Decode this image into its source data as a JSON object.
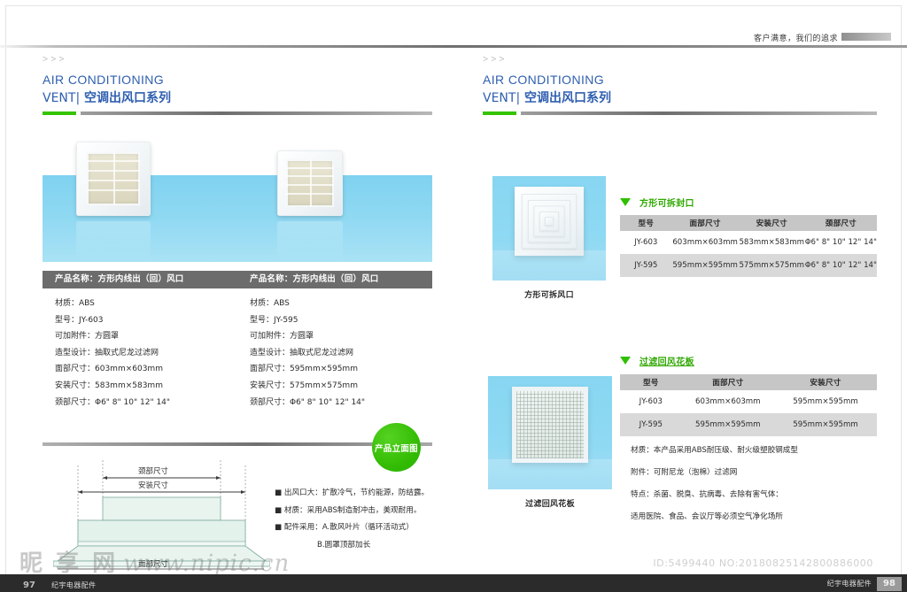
{
  "header": {
    "slogan": "客户满意，我们的追求"
  },
  "section_heading": {
    "arrows": ">>>",
    "english": "AIR CONDITIONING",
    "vent": "VENT|",
    "chinese": " 空调出风口系列"
  },
  "left_page": {
    "hero": {
      "product_left_alt": "方形内线出风口",
      "product_right_alt": "方形内线出风口"
    },
    "spec_columns": [
      {
        "title": "产品名称：方形内线出（回）风口",
        "rows": [
          "材质：ABS",
          "型号：JY-603",
          "可加附件：方圆罩",
          "造型设计：抽取式尼龙过滤网",
          "面部尺寸：603mm×603mm",
          "安装尺寸：583mm×583mm",
          "颈部尺寸：Φ6\" 8\"  10\"  12\"  14\""
        ]
      },
      {
        "title": "产品名称：方形内线出（回）风口",
        "rows": [
          "材质：ABS",
          "型号：JY-595",
          "可加附件：方圆罩",
          "造型设计：抽取式尼龙过滤网",
          "面部尺寸：595mm×595mm",
          "安装尺寸：575mm×575mm",
          "颈部尺寸：Φ6\" 8\"  10\"  12\"  14\""
        ]
      }
    ],
    "badge_label": "产品立面图",
    "drawing": {
      "neck_label": "颈部尺寸",
      "install_label": "安装尺寸",
      "face_label": "面部尺寸"
    },
    "bullets": [
      "■ 出风口大：扩散冷气，节约能源，防结露。",
      "■ 材质：采用ABS制造耐冲击，美观耐用。",
      "■ 配件采用：A.散风叶片（循环活动式）",
      "B.圆罩顶部加长"
    ]
  },
  "right_page": {
    "sections": [
      {
        "title": "方形可拆封口",
        "photo_caption": "方形可拆风口",
        "columns": [
          "型号",
          "面部尺寸",
          "安装尺寸",
          "颈部尺寸"
        ],
        "rows": [
          [
            "JY-603",
            "603mm×603mm",
            "583mm×583mm",
            "Φ6\" 8\"  10\"  12\"  14\""
          ],
          [
            "JY-595",
            "595mm×595mm",
            "575mm×575mm",
            "Φ6\" 8\"  10\"  12\"  14\""
          ]
        ]
      },
      {
        "title": "过滤回风花板",
        "photo_caption": "过滤回风花板",
        "columns": [
          "型号",
          "面部尺寸",
          "安装尺寸"
        ],
        "rows": [
          [
            "JY-603",
            "603mm×603mm",
            "595mm×595mm"
          ],
          [
            "JY-595",
            "595mm×595mm",
            "595mm×595mm"
          ]
        ],
        "notes": [
          "材质：本产品采用ABS耐压级、耐火级塑胶钢成型",
          "附件：可附尼龙（泡棉）过滤网",
          "特点：杀菌、脱臭、抗病毒、去除有害气体：",
          "适用医院、食品、会议厅等必须空气净化场所"
        ]
      }
    ]
  },
  "footer": {
    "brand_left": "纪宇电器配件",
    "brand_right": "纪宇电器配件",
    "page_left": "97",
    "page_right": "98",
    "stock_id": "ID:5499440 NO:20180825142800886000"
  },
  "watermark": {
    "logo": "昵 享 网",
    "url": "www.nipic.cn"
  },
  "colors": {
    "accent_blue": "#2f5fb0",
    "accent_green": "#35c400",
    "bar_dark": "#6c6c6c",
    "table_header": "#c6c6c6",
    "photo_bg": "#8fd9f3"
  }
}
